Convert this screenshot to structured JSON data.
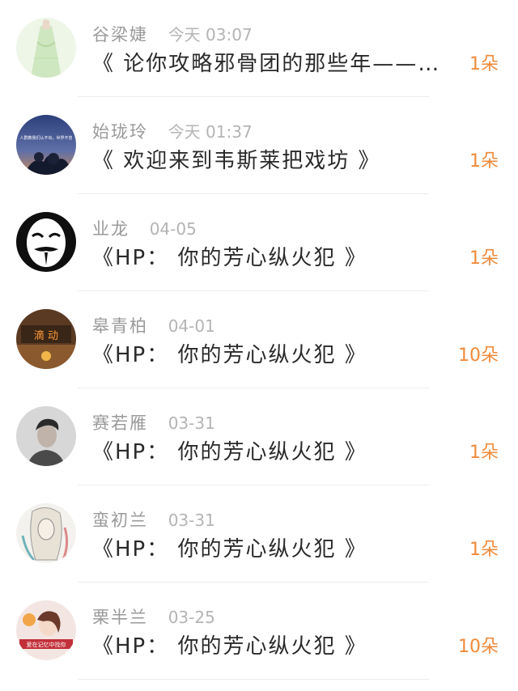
{
  "items": [
    {
      "name": "谷梁婕",
      "time": "今天 03:07",
      "title": "《 论你攻略邪骨团的那些年——…",
      "count": "1朵",
      "avatar": "girl-in-green-dress"
    },
    {
      "name": "始珑玲",
      "time": "今天 01:37",
      "title": "《 欢迎来到韦斯莱把戏坊 》",
      "count": "1朵",
      "avatar": "night-sky-tree"
    },
    {
      "name": "业龙",
      "time": "04-05",
      "title": "《HP： 你的芳心纵火犯 》",
      "count": "1朵",
      "avatar": "masked-face"
    },
    {
      "name": "皋青柏",
      "time": "04-01",
      "title": "《HP： 你的芳心纵火犯 》",
      "count": "10朵",
      "avatar": "neon-room"
    },
    {
      "name": "赛若雁",
      "time": "03-31",
      "title": "《HP： 你的芳心纵火犯 》",
      "count": "1朵",
      "avatar": "young-man-portrait"
    },
    {
      "name": "蛮初兰",
      "time": "03-31",
      "title": "《HP： 你的芳心纵火犯 》",
      "count": "1朵",
      "avatar": "sketch-girl"
    },
    {
      "name": "栗半兰",
      "time": "03-25",
      "title": "《HP： 你的芳心纵火犯 》",
      "count": "10朵",
      "avatar": "girl-with-banner"
    }
  ],
  "colors": {
    "accent": "#f08a3a",
    "name": "#9a9a9a",
    "title": "#2a2a2a",
    "divider": "#ececec"
  },
  "avatar_texts": {
    "night_sky_tree": "人群教我们认不出，世界不曾",
    "neon_room": "滴 动",
    "girl_with_banner": "爱在记忆中找你"
  }
}
